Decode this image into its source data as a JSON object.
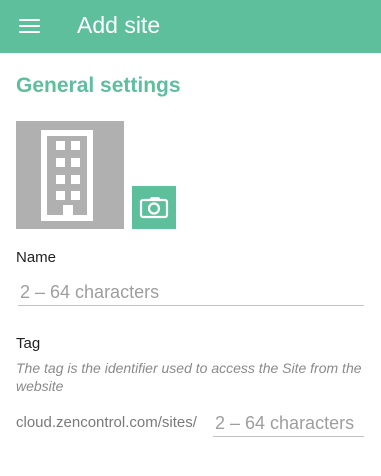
{
  "appbar": {
    "title": "Add site",
    "menu_icon": "menu-icon",
    "color": "#5dbf9c"
  },
  "general": {
    "section_title": "General settings",
    "image_icon": "building-icon",
    "camera_icon": "camera-icon"
  },
  "name_field": {
    "label": "Name",
    "value": "",
    "placeholder": "2 – 64 characters"
  },
  "tag_field": {
    "label": "Tag",
    "helper": "The tag is the identifier used to access the Site from the website",
    "prefix": "cloud.zencontrol.com/sites/",
    "value": "",
    "placeholder": "2 – 64 characters"
  }
}
